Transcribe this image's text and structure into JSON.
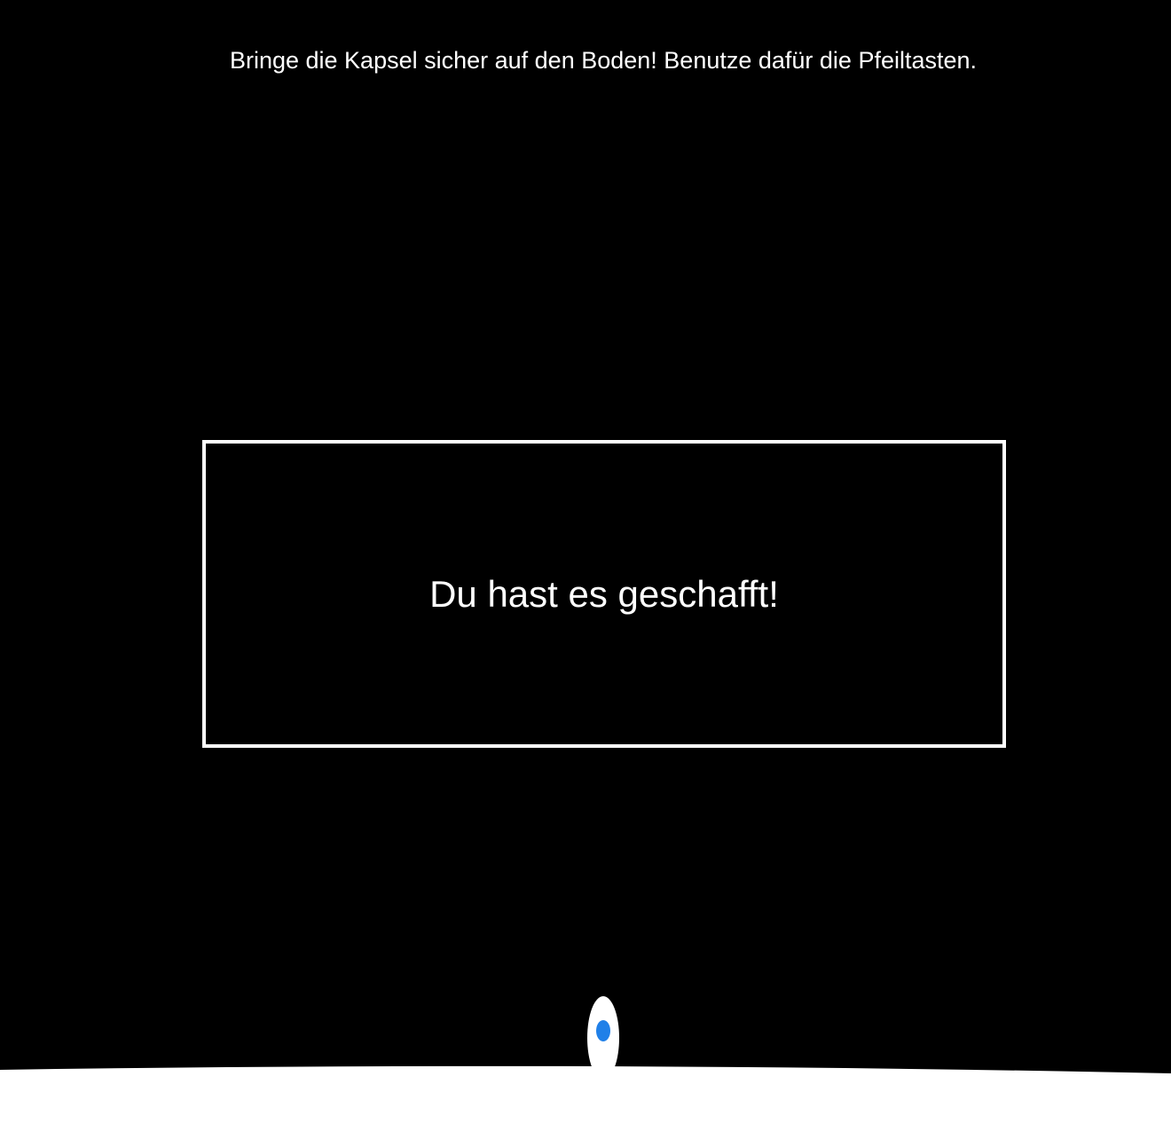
{
  "game": {
    "instructions": "Bringe die Kapsel sicher auf den Boden! Benutze dafür die Pfeiltasten.",
    "message": "Du hast es geschafft!"
  },
  "colors": {
    "background": "#000000",
    "ground": "#ffffff",
    "capsule_body": "#ffffff",
    "capsule_window": "#2080e8",
    "text": "#ffffff"
  }
}
